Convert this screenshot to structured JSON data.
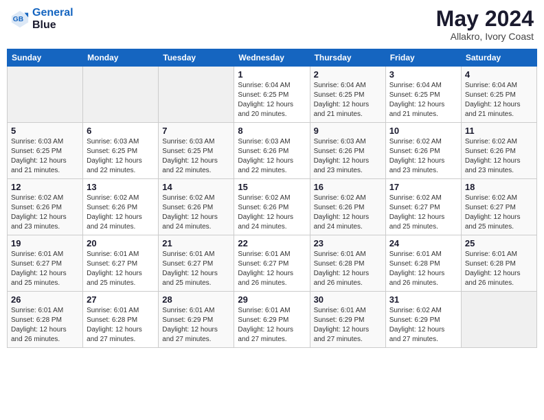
{
  "header": {
    "logo_line1": "General",
    "logo_line2": "Blue",
    "month_year": "May 2024",
    "location": "Allakro, Ivory Coast"
  },
  "days_of_week": [
    "Sunday",
    "Monday",
    "Tuesday",
    "Wednesday",
    "Thursday",
    "Friday",
    "Saturday"
  ],
  "weeks": [
    [
      {
        "day": "",
        "info": ""
      },
      {
        "day": "",
        "info": ""
      },
      {
        "day": "",
        "info": ""
      },
      {
        "day": "1",
        "info": "Sunrise: 6:04 AM\nSunset: 6:25 PM\nDaylight: 12 hours\nand 20 minutes."
      },
      {
        "day": "2",
        "info": "Sunrise: 6:04 AM\nSunset: 6:25 PM\nDaylight: 12 hours\nand 21 minutes."
      },
      {
        "day": "3",
        "info": "Sunrise: 6:04 AM\nSunset: 6:25 PM\nDaylight: 12 hours\nand 21 minutes."
      },
      {
        "day": "4",
        "info": "Sunrise: 6:04 AM\nSunset: 6:25 PM\nDaylight: 12 hours\nand 21 minutes."
      }
    ],
    [
      {
        "day": "5",
        "info": "Sunrise: 6:03 AM\nSunset: 6:25 PM\nDaylight: 12 hours\nand 21 minutes."
      },
      {
        "day": "6",
        "info": "Sunrise: 6:03 AM\nSunset: 6:25 PM\nDaylight: 12 hours\nand 22 minutes."
      },
      {
        "day": "7",
        "info": "Sunrise: 6:03 AM\nSunset: 6:25 PM\nDaylight: 12 hours\nand 22 minutes."
      },
      {
        "day": "8",
        "info": "Sunrise: 6:03 AM\nSunset: 6:26 PM\nDaylight: 12 hours\nand 22 minutes."
      },
      {
        "day": "9",
        "info": "Sunrise: 6:03 AM\nSunset: 6:26 PM\nDaylight: 12 hours\nand 23 minutes."
      },
      {
        "day": "10",
        "info": "Sunrise: 6:02 AM\nSunset: 6:26 PM\nDaylight: 12 hours\nand 23 minutes."
      },
      {
        "day": "11",
        "info": "Sunrise: 6:02 AM\nSunset: 6:26 PM\nDaylight: 12 hours\nand 23 minutes."
      }
    ],
    [
      {
        "day": "12",
        "info": "Sunrise: 6:02 AM\nSunset: 6:26 PM\nDaylight: 12 hours\nand 23 minutes."
      },
      {
        "day": "13",
        "info": "Sunrise: 6:02 AM\nSunset: 6:26 PM\nDaylight: 12 hours\nand 24 minutes."
      },
      {
        "day": "14",
        "info": "Sunrise: 6:02 AM\nSunset: 6:26 PM\nDaylight: 12 hours\nand 24 minutes."
      },
      {
        "day": "15",
        "info": "Sunrise: 6:02 AM\nSunset: 6:26 PM\nDaylight: 12 hours\nand 24 minutes."
      },
      {
        "day": "16",
        "info": "Sunrise: 6:02 AM\nSunset: 6:26 PM\nDaylight: 12 hours\nand 24 minutes."
      },
      {
        "day": "17",
        "info": "Sunrise: 6:02 AM\nSunset: 6:27 PM\nDaylight: 12 hours\nand 25 minutes."
      },
      {
        "day": "18",
        "info": "Sunrise: 6:02 AM\nSunset: 6:27 PM\nDaylight: 12 hours\nand 25 minutes."
      }
    ],
    [
      {
        "day": "19",
        "info": "Sunrise: 6:01 AM\nSunset: 6:27 PM\nDaylight: 12 hours\nand 25 minutes."
      },
      {
        "day": "20",
        "info": "Sunrise: 6:01 AM\nSunset: 6:27 PM\nDaylight: 12 hours\nand 25 minutes."
      },
      {
        "day": "21",
        "info": "Sunrise: 6:01 AM\nSunset: 6:27 PM\nDaylight: 12 hours\nand 25 minutes."
      },
      {
        "day": "22",
        "info": "Sunrise: 6:01 AM\nSunset: 6:27 PM\nDaylight: 12 hours\nand 26 minutes."
      },
      {
        "day": "23",
        "info": "Sunrise: 6:01 AM\nSunset: 6:28 PM\nDaylight: 12 hours\nand 26 minutes."
      },
      {
        "day": "24",
        "info": "Sunrise: 6:01 AM\nSunset: 6:28 PM\nDaylight: 12 hours\nand 26 minutes."
      },
      {
        "day": "25",
        "info": "Sunrise: 6:01 AM\nSunset: 6:28 PM\nDaylight: 12 hours\nand 26 minutes."
      }
    ],
    [
      {
        "day": "26",
        "info": "Sunrise: 6:01 AM\nSunset: 6:28 PM\nDaylight: 12 hours\nand 26 minutes."
      },
      {
        "day": "27",
        "info": "Sunrise: 6:01 AM\nSunset: 6:28 PM\nDaylight: 12 hours\nand 27 minutes."
      },
      {
        "day": "28",
        "info": "Sunrise: 6:01 AM\nSunset: 6:29 PM\nDaylight: 12 hours\nand 27 minutes."
      },
      {
        "day": "29",
        "info": "Sunrise: 6:01 AM\nSunset: 6:29 PM\nDaylight: 12 hours\nand 27 minutes."
      },
      {
        "day": "30",
        "info": "Sunrise: 6:01 AM\nSunset: 6:29 PM\nDaylight: 12 hours\nand 27 minutes."
      },
      {
        "day": "31",
        "info": "Sunrise: 6:02 AM\nSunset: 6:29 PM\nDaylight: 12 hours\nand 27 minutes."
      },
      {
        "day": "",
        "info": ""
      }
    ]
  ]
}
